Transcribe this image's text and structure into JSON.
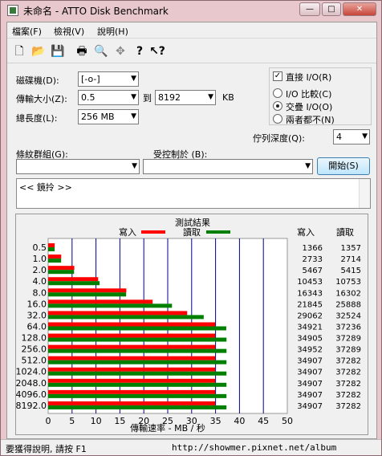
{
  "window": {
    "title": "未命名 - ATTO Disk Benchmark",
    "minimize_glyph": "—",
    "maximize_glyph": "□",
    "close_glyph": "✕"
  },
  "menu": [
    "檔案(F)",
    "檢視(V)",
    "說明(H)"
  ],
  "toolbar": [
    "new-icon",
    "open-icon",
    "save-icon",
    "print-icon",
    "print-preview-icon",
    "move-icon",
    "help-icon",
    "context-help-icon"
  ],
  "form": {
    "drive_label": "磁碟機(D):",
    "drive_value": "[-o-]",
    "transfer_label": "傳輸大小(Z):",
    "transfer_from": "0.5",
    "to_label": "到",
    "transfer_to": "8192",
    "kb_label": "KB",
    "length_label": "總長度(L):",
    "length_value": "256 MB",
    "direct_io_label": "直接 I/O(R)",
    "direct_io_checked": true,
    "io_compare_label": "I/O 比較(C)",
    "overlapped_label": "交疊 I/O(O)",
    "neither_label": "兩者都不(N)",
    "queue_label": "佇列深度(Q):",
    "queue_value": "4",
    "pattern_label": "條紋群組(G):",
    "pattern_value": "",
    "controlled_label": "受控制於 (B):",
    "controlled_value": "",
    "start_button": "開始(S)",
    "description_text": "<< 鏡拎 >>"
  },
  "results": {
    "title": "測試結果",
    "write_legend": "寫入",
    "read_legend": "讀取",
    "write_header": "寫入",
    "read_header": "讀取",
    "xlabel": "傳輸速率 - MB / 秒"
  },
  "status": {
    "help_text": "要獲得說明, 請按 F1",
    "watermark": "http://showmer.pixnet.net/album"
  },
  "colors": {
    "write": "#ff0000",
    "read": "#008000",
    "grid": "#00008b"
  },
  "chart_data": {
    "type": "bar",
    "orientation": "horizontal",
    "title": "測試結果",
    "xlabel": "傳輸速率 - MB / 秒",
    "categories": [
      "0.5",
      "1.0",
      "2.0",
      "4.0",
      "8.0",
      "16.0",
      "32.0",
      "64.0",
      "128.0",
      "256.0",
      "512.0",
      "1024.0",
      "2048.0",
      "4096.0",
      "8192.0"
    ],
    "xlim": [
      0,
      50
    ],
    "xticks": [
      0,
      5,
      10,
      15,
      20,
      25,
      30,
      35,
      40,
      45,
      50
    ],
    "series": [
      {
        "name": "寫入",
        "color": "#ff0000",
        "values": [
          1366,
          2733,
          5467,
          10453,
          16343,
          21845,
          29062,
          34921,
          34905,
          34952,
          34907,
          34907,
          34907,
          34907,
          34907
        ]
      },
      {
        "name": "讀取",
        "color": "#008000",
        "values": [
          1357,
          2714,
          5415,
          10753,
          16302,
          25888,
          32524,
          37236,
          37289,
          37289,
          37282,
          37282,
          37282,
          37282,
          37282
        ]
      }
    ]
  }
}
